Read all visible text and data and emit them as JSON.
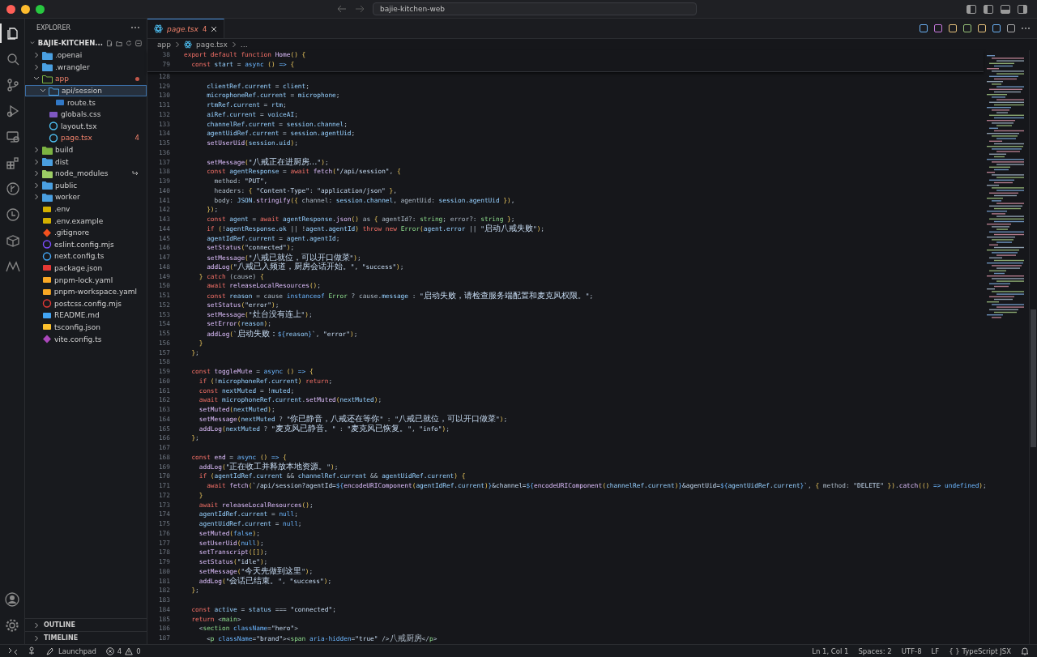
{
  "titlebar": {
    "search": "bajie-kitchen-web"
  },
  "activity_bar": [
    {
      "kind": "files",
      "selected": true
    },
    {
      "kind": "search",
      "selected": false
    },
    {
      "kind": "source-control",
      "selected": false
    },
    {
      "kind": "run-debug",
      "selected": false
    },
    {
      "kind": "remote",
      "selected": false
    },
    {
      "kind": "extensions",
      "selected": false
    },
    {
      "kind": "graph",
      "selected": false
    },
    {
      "kind": "history",
      "selected": false
    },
    {
      "kind": "box",
      "selected": false
    },
    {
      "kind": "m-logo",
      "selected": false
    }
  ],
  "explorer": {
    "title": "EXPLORER",
    "project": "BAJIE-KITCHEN...",
    "tree": [
      {
        "name": ".openai",
        "kind": "folder",
        "expanded": false,
        "selected": false,
        "problem": false
      },
      {
        "name": ".wrangler",
        "kind": "folder",
        "expanded": false,
        "selected": false,
        "problem": false
      },
      {
        "name": "app",
        "kind": "folder-app",
        "expanded": true,
        "selected": false,
        "problem": true,
        "children": [
          {
            "name": "api/session",
            "kind": "folder",
            "expanded": true,
            "selected": true,
            "problem": false,
            "children": [
              {
                "name": "route.ts",
                "kind": "ts",
                "selected": false,
                "problem": false
              }
            ]
          },
          {
            "name": "globals.css",
            "kind": "css",
            "selected": false,
            "problem": false
          },
          {
            "name": "layout.tsx",
            "kind": "react",
            "selected": false,
            "problem": false
          },
          {
            "name": "page.tsx",
            "kind": "react",
            "selected": false,
            "problem": true,
            "badge": "4"
          }
        ]
      },
      {
        "name": "build",
        "kind": "folder-build",
        "expanded": false,
        "selected": false,
        "problem": false
      },
      {
        "name": "dist",
        "kind": "folder",
        "expanded": false,
        "selected": false,
        "problem": false
      },
      {
        "name": "node_modules",
        "kind": "folder-linked",
        "expanded": false,
        "selected": false,
        "problem": false
      },
      {
        "name": "public",
        "kind": "folder",
        "expanded": false,
        "selected": false,
        "problem": false
      },
      {
        "name": "worker",
        "kind": "folder",
        "expanded": false,
        "selected": false,
        "problem": false
      },
      {
        "name": ".env",
        "kind": "env",
        "selected": false,
        "problem": false
      },
      {
        "name": ".env.example",
        "kind": "env",
        "selected": false,
        "problem": false
      },
      {
        "name": ".gitignore",
        "kind": "git",
        "selected": false,
        "problem": false
      },
      {
        "name": "eslint.config.mjs",
        "kind": "eslint",
        "selected": false,
        "problem": false
      },
      {
        "name": "next.config.ts",
        "kind": "next",
        "selected": false,
        "problem": false
      },
      {
        "name": "package.json",
        "kind": "npm",
        "selected": false,
        "problem": false
      },
      {
        "name": "pnpm-lock.yaml",
        "kind": "yaml",
        "selected": false,
        "problem": false
      },
      {
        "name": "pnpm-workspace.yaml",
        "kind": "yaml",
        "selected": false,
        "problem": false
      },
      {
        "name": "postcss.config.mjs",
        "kind": "postcss",
        "selected": false,
        "problem": false
      },
      {
        "name": "README.md",
        "kind": "md",
        "selected": false,
        "problem": false
      },
      {
        "name": "tsconfig.json",
        "kind": "json",
        "selected": false,
        "problem": false
      },
      {
        "name": "vite.config.ts",
        "kind": "vite",
        "selected": false,
        "problem": false
      }
    ],
    "sections": [
      {
        "title": "OUTLINE",
        "expanded": false
      },
      {
        "title": "TIMELINE",
        "expanded": false
      }
    ]
  },
  "editor": {
    "tabs": [
      {
        "name": "page.tsx",
        "badge": "4",
        "selected": true,
        "problem": true
      }
    ],
    "breadcrumbs": [
      {
        "text": "app",
        "kind": "folder"
      },
      {
        "text": "page.tsx",
        "kind": "react"
      },
      {
        "text": "…",
        "kind": "more"
      }
    ],
    "sticky_lines": [
      {
        "number": "38",
        "tokens": [
          {
            "kind": "kw",
            "text": "export default function "
          },
          {
            "kind": "fn",
            "text": "Home"
          },
          {
            "kind": "br",
            "text": "() {"
          }
        ]
      },
      {
        "number": "79",
        "tokens": [
          {
            "kind": "kw",
            "text": "  const "
          },
          {
            "kind": "var",
            "text": "start"
          },
          {
            "kind": "pl",
            "text": " = "
          },
          {
            "kind": "st",
            "text": "async "
          },
          {
            "kind": "br",
            "text": "()"
          },
          {
            "kind": "st",
            "text": " => "
          },
          {
            "kind": "br",
            "text": "{"
          }
        ]
      }
    ],
    "lines": [
      {
        "number": "128"
      },
      {
        "number": "129",
        "tokens": [
          {
            "kind": "var",
            "text": "      clientRef.current"
          },
          {
            "kind": "pl",
            "text": " = "
          },
          {
            "kind": "var",
            "text": "client"
          },
          {
            "kind": "pl",
            "text": ";"
          }
        ]
      },
      {
        "number": "130",
        "tokens": [
          {
            "kind": "var",
            "text": "      microphoneRef.current"
          },
          {
            "kind": "pl",
            "text": " = "
          },
          {
            "kind": "var",
            "text": "microphone"
          },
          {
            "kind": "pl",
            "text": ";"
          }
        ]
      },
      {
        "number": "131",
        "tokens": [
          {
            "kind": "var",
            "text": "      rtmRef.current"
          },
          {
            "kind": "pl",
            "text": " = "
          },
          {
            "kind": "var",
            "text": "rtm"
          },
          {
            "kind": "pl",
            "text": ";"
          }
        ]
      },
      {
        "number": "132",
        "tokens": [
          {
            "kind": "var",
            "text": "      aiRef.current"
          },
          {
            "kind": "pl",
            "text": " = "
          },
          {
            "kind": "var",
            "text": "voiceAI"
          },
          {
            "kind": "pl",
            "text": ";"
          }
        ]
      },
      {
        "number": "133",
        "tokens": [
          {
            "kind": "var",
            "text": "      channelRef.current"
          },
          {
            "kind": "pl",
            "text": " = "
          },
          {
            "kind": "var",
            "text": "session.channel"
          },
          {
            "kind": "pl",
            "text": ";"
          }
        ]
      },
      {
        "number": "134",
        "tokens": [
          {
            "kind": "var",
            "text": "      agentUidRef.current"
          },
          {
            "kind": "pl",
            "text": " = "
          },
          {
            "kind": "var",
            "text": "session.agentUid"
          },
          {
            "kind": "pl",
            "text": ";"
          }
        ]
      },
      {
        "number": "135",
        "tokens": [
          {
            "kind": "fn",
            "text": "      setUserUid"
          },
          {
            "kind": "br",
            "text": "("
          },
          {
            "kind": "var",
            "text": "session.uid"
          },
          {
            "kind": "br",
            "text": ")"
          },
          {
            "kind": "pl",
            "text": ";"
          }
        ]
      },
      {
        "number": "136"
      },
      {
        "number": "137",
        "tokens": [
          {
            "kind": "fn",
            "text": "      setMessage"
          },
          {
            "kind": "br",
            "text": "("
          },
          {
            "kind": "str",
            "text": "\"八戒正在进厨房…\""
          },
          {
            "kind": "br",
            "text": ")"
          },
          {
            "kind": "pl",
            "text": ";"
          }
        ]
      },
      {
        "number": "138",
        "tokens": [
          {
            "kind": "kw",
            "text": "      const "
          },
          {
            "kind": "var",
            "text": "agentResponse"
          },
          {
            "kind": "pl",
            "text": " = "
          },
          {
            "kind": "kw",
            "text": "await "
          },
          {
            "kind": "fn",
            "text": "fetch"
          },
          {
            "kind": "br",
            "text": "("
          },
          {
            "kind": "str",
            "text": "\"/api/session\""
          },
          {
            "kind": "pl",
            "text": ", "
          },
          {
            "kind": "br",
            "text": "{"
          }
        ]
      },
      {
        "number": "139",
        "tokens": [
          {
            "kind": "pl",
            "text": "        method: "
          },
          {
            "kind": "str",
            "text": "\"PUT\""
          },
          {
            "kind": "pl",
            "text": ","
          }
        ]
      },
      {
        "number": "140",
        "tokens": [
          {
            "kind": "pl",
            "text": "        headers: "
          },
          {
            "kind": "br",
            "text": "{ "
          },
          {
            "kind": "str",
            "text": "\"Content-Type\""
          },
          {
            "kind": "pl",
            "text": ": "
          },
          {
            "kind": "str",
            "text": "\"application/json\""
          },
          {
            "kind": "br",
            "text": " }"
          },
          {
            "kind": "pl",
            "text": ","
          }
        ]
      },
      {
        "number": "141",
        "tokens": [
          {
            "kind": "pl",
            "text": "        body: "
          },
          {
            "kind": "var",
            "text": "JSON"
          },
          {
            "kind": "pl",
            "text": "."
          },
          {
            "kind": "fn",
            "text": "stringify"
          },
          {
            "kind": "br",
            "text": "({ "
          },
          {
            "kind": "pl",
            "text": "channel: "
          },
          {
            "kind": "var",
            "text": "session.channel"
          },
          {
            "kind": "pl",
            "text": ", agentUid: "
          },
          {
            "kind": "var",
            "text": "session.agentUid"
          },
          {
            "kind": "br",
            "text": " })"
          },
          {
            "kind": "pl",
            "text": ","
          }
        ]
      },
      {
        "number": "142",
        "tokens": [
          {
            "kind": "br",
            "text": "      })"
          },
          {
            "kind": "pl",
            "text": ";"
          }
        ]
      },
      {
        "number": "143",
        "tokens": [
          {
            "kind": "kw",
            "text": "      const "
          },
          {
            "kind": "var",
            "text": "agent"
          },
          {
            "kind": "pl",
            "text": " = "
          },
          {
            "kind": "kw",
            "text": "await "
          },
          {
            "kind": "var",
            "text": "agentResponse"
          },
          {
            "kind": "pl",
            "text": "."
          },
          {
            "kind": "fn",
            "text": "json"
          },
          {
            "kind": "br",
            "text": "()"
          },
          {
            "kind": "pl",
            "text": " as "
          },
          {
            "kind": "br",
            "text": "{ "
          },
          {
            "kind": "pl",
            "text": "agentId?: "
          },
          {
            "kind": "ty",
            "text": "string"
          },
          {
            "kind": "pl",
            "text": "; error?: "
          },
          {
            "kind": "ty",
            "text": "string"
          },
          {
            "kind": "br",
            "text": " }"
          },
          {
            "kind": "pl",
            "text": ";"
          }
        ]
      },
      {
        "number": "144",
        "tokens": [
          {
            "kind": "kw",
            "text": "      if "
          },
          {
            "kind": "br",
            "text": "("
          },
          {
            "kind": "pl",
            "text": "!"
          },
          {
            "kind": "var",
            "text": "agentResponse.ok"
          },
          {
            "kind": "pl",
            "text": " || !"
          },
          {
            "kind": "var",
            "text": "agent.agentId"
          },
          {
            "kind": "br",
            "text": ")"
          },
          {
            "kind": "kw",
            "text": " throw new "
          },
          {
            "kind": "ty",
            "text": "Error"
          },
          {
            "kind": "br",
            "text": "("
          },
          {
            "kind": "var",
            "text": "agent.error"
          },
          {
            "kind": "pl",
            "text": " || "
          },
          {
            "kind": "str",
            "text": "\"启动八戒失败\""
          },
          {
            "kind": "br",
            "text": ")"
          },
          {
            "kind": "pl",
            "text": ";"
          }
        ]
      },
      {
        "number": "145",
        "tokens": [
          {
            "kind": "var",
            "text": "      agentIdRef.current"
          },
          {
            "kind": "pl",
            "text": " = "
          },
          {
            "kind": "var",
            "text": "agent.agentId"
          },
          {
            "kind": "pl",
            "text": ";"
          }
        ]
      },
      {
        "number": "146",
        "tokens": [
          {
            "kind": "fn",
            "text": "      setStatus"
          },
          {
            "kind": "br",
            "text": "("
          },
          {
            "kind": "str",
            "text": "\"connected\""
          },
          {
            "kind": "br",
            "text": ")"
          },
          {
            "kind": "pl",
            "text": ";"
          }
        ]
      },
      {
        "number": "147",
        "tokens": [
          {
            "kind": "fn",
            "text": "      setMessage"
          },
          {
            "kind": "br",
            "text": "("
          },
          {
            "kind": "str",
            "text": "\"八戒已就位，可以开口做菜\""
          },
          {
            "kind": "br",
            "text": ")"
          },
          {
            "kind": "pl",
            "text": ";"
          }
        ]
      },
      {
        "number": "148",
        "tokens": [
          {
            "kind": "fn",
            "text": "      addLog"
          },
          {
            "kind": "br",
            "text": "("
          },
          {
            "kind": "str",
            "text": "\"八戒已入频道，厨房会话开始。\""
          },
          {
            "kind": "pl",
            "text": ", "
          },
          {
            "kind": "str",
            "text": "\"success\""
          },
          {
            "kind": "br",
            "text": ")"
          },
          {
            "kind": "pl",
            "text": ";"
          }
        ]
      },
      {
        "number": "149",
        "tokens": [
          {
            "kind": "br",
            "text": "    }"
          },
          {
            "kind": "kw",
            "text": " catch "
          },
          {
            "kind": "pl",
            "text": "(cause) "
          },
          {
            "kind": "br",
            "text": "{"
          }
        ]
      },
      {
        "number": "150",
        "tokens": [
          {
            "kind": "kw",
            "text": "      await "
          },
          {
            "kind": "fn",
            "text": "releaseLocalResources"
          },
          {
            "kind": "br",
            "text": "()"
          },
          {
            "kind": "pl",
            "text": ";"
          }
        ]
      },
      {
        "number": "151",
        "tokens": [
          {
            "kind": "kw",
            "text": "      const "
          },
          {
            "kind": "var",
            "text": "reason"
          },
          {
            "kind": "pl",
            "text": " = cause "
          },
          {
            "kind": "st",
            "text": "instanceof "
          },
          {
            "kind": "ty",
            "text": "Error"
          },
          {
            "kind": "pl",
            "text": " ? cause."
          },
          {
            "kind": "var",
            "text": "message"
          },
          {
            "kind": "pl",
            "text": " : "
          },
          {
            "kind": "str",
            "text": "\"启动失败，请检查服务端配置和麦克风权限。\""
          },
          {
            "kind": "pl",
            "text": ";"
          }
        ]
      },
      {
        "number": "152",
        "tokens": [
          {
            "kind": "fn",
            "text": "      setStatus"
          },
          {
            "kind": "br",
            "text": "("
          },
          {
            "kind": "str",
            "text": "\"error\""
          },
          {
            "kind": "br",
            "text": ")"
          },
          {
            "kind": "pl",
            "text": ";"
          }
        ]
      },
      {
        "number": "153",
        "tokens": [
          {
            "kind": "fn",
            "text": "      setMessage"
          },
          {
            "kind": "br",
            "text": "("
          },
          {
            "kind": "str",
            "text": "\"灶台没有连上\""
          },
          {
            "kind": "br",
            "text": ")"
          },
          {
            "kind": "pl",
            "text": ";"
          }
        ]
      },
      {
        "number": "154",
        "tokens": [
          {
            "kind": "fn",
            "text": "      setError"
          },
          {
            "kind": "br",
            "text": "("
          },
          {
            "kind": "var",
            "text": "reason"
          },
          {
            "kind": "br",
            "text": ")"
          },
          {
            "kind": "pl",
            "text": ";"
          }
        ]
      },
      {
        "number": "155",
        "tokens": [
          {
            "kind": "fn",
            "text": "      addLog"
          },
          {
            "kind": "br",
            "text": "("
          },
          {
            "kind": "str",
            "text": "`启动失败："
          },
          {
            "kind": "st",
            "text": "${"
          },
          {
            "kind": "var",
            "text": "reason"
          },
          {
            "kind": "st",
            "text": "}"
          },
          {
            "kind": "str",
            "text": "`"
          },
          {
            "kind": "pl",
            "text": ", "
          },
          {
            "kind": "str",
            "text": "\"error\""
          },
          {
            "kind": "br",
            "text": ")"
          },
          {
            "kind": "pl",
            "text": ";"
          }
        ]
      },
      {
        "number": "156",
        "tokens": [
          {
            "kind": "br",
            "text": "    }"
          }
        ]
      },
      {
        "number": "157",
        "tokens": [
          {
            "kind": "br",
            "text": "  }"
          },
          {
            "kind": "pl",
            "text": ";"
          }
        ]
      },
      {
        "number": "158"
      },
      {
        "number": "159",
        "tokens": [
          {
            "kind": "kw",
            "text": "  const "
          },
          {
            "kind": "fn",
            "text": "toggleMute"
          },
          {
            "kind": "pl",
            "text": " = "
          },
          {
            "kind": "st",
            "text": "async "
          },
          {
            "kind": "br",
            "text": "()"
          },
          {
            "kind": "st",
            "text": " => "
          },
          {
            "kind": "br",
            "text": "{"
          }
        ]
      },
      {
        "number": "160",
        "tokens": [
          {
            "kind": "kw",
            "text": "    if "
          },
          {
            "kind": "br",
            "text": "("
          },
          {
            "kind": "pl",
            "text": "!"
          },
          {
            "kind": "var",
            "text": "microphoneRef.current"
          },
          {
            "kind": "br",
            "text": ")"
          },
          {
            "kind": "kw",
            "text": " return"
          },
          {
            "kind": "pl",
            "text": ";"
          }
        ]
      },
      {
        "number": "161",
        "tokens": [
          {
            "kind": "kw",
            "text": "    const "
          },
          {
            "kind": "var",
            "text": "nextMuted"
          },
          {
            "kind": "pl",
            "text": " = !"
          },
          {
            "kind": "var",
            "text": "muted"
          },
          {
            "kind": "pl",
            "text": ";"
          }
        ]
      },
      {
        "number": "162",
        "tokens": [
          {
            "kind": "kw",
            "text": "    await "
          },
          {
            "kind": "var",
            "text": "microphoneRef.current"
          },
          {
            "kind": "pl",
            "text": "."
          },
          {
            "kind": "fn",
            "text": "setMuted"
          },
          {
            "kind": "br",
            "text": "("
          },
          {
            "kind": "var",
            "text": "nextMuted"
          },
          {
            "kind": "br",
            "text": ")"
          },
          {
            "kind": "pl",
            "text": ";"
          }
        ]
      },
      {
        "number": "163",
        "tokens": [
          {
            "kind": "fn",
            "text": "    setMuted"
          },
          {
            "kind": "br",
            "text": "("
          },
          {
            "kind": "var",
            "text": "nextMuted"
          },
          {
            "kind": "br",
            "text": ")"
          },
          {
            "kind": "pl",
            "text": ";"
          }
        ]
      },
      {
        "number": "164",
        "tokens": [
          {
            "kind": "fn",
            "text": "    setMessage"
          },
          {
            "kind": "br",
            "text": "("
          },
          {
            "kind": "var",
            "text": "nextMuted"
          },
          {
            "kind": "pl",
            "text": " ? "
          },
          {
            "kind": "str",
            "text": "\"你已静音，八戒还在等你\""
          },
          {
            "kind": "pl",
            "text": " : "
          },
          {
            "kind": "str",
            "text": "\"八戒已就位，可以开口做菜\""
          },
          {
            "kind": "br",
            "text": ")"
          },
          {
            "kind": "pl",
            "text": ";"
          }
        ]
      },
      {
        "number": "165",
        "tokens": [
          {
            "kind": "fn",
            "text": "    addLog"
          },
          {
            "kind": "br",
            "text": "("
          },
          {
            "kind": "var",
            "text": "nextMuted"
          },
          {
            "kind": "pl",
            "text": " ? "
          },
          {
            "kind": "str",
            "text": "\"麦克风已静音。\""
          },
          {
            "kind": "pl",
            "text": " : "
          },
          {
            "kind": "str",
            "text": "\"麦克风已恢复。\""
          },
          {
            "kind": "pl",
            "text": ", "
          },
          {
            "kind": "str",
            "text": "\"info\""
          },
          {
            "kind": "br",
            "text": ")"
          },
          {
            "kind": "pl",
            "text": ";"
          }
        ]
      },
      {
        "number": "166",
        "tokens": [
          {
            "kind": "br",
            "text": "  }"
          },
          {
            "kind": "pl",
            "text": ";"
          }
        ]
      },
      {
        "number": "167"
      },
      {
        "number": "168",
        "tokens": [
          {
            "kind": "kw",
            "text": "  const "
          },
          {
            "kind": "fn",
            "text": "end"
          },
          {
            "kind": "pl",
            "text": " = "
          },
          {
            "kind": "st",
            "text": "async "
          },
          {
            "kind": "br",
            "text": "()"
          },
          {
            "kind": "st",
            "text": " => "
          },
          {
            "kind": "br",
            "text": "{"
          }
        ]
      },
      {
        "number": "169",
        "tokens": [
          {
            "kind": "fn",
            "text": "    addLog"
          },
          {
            "kind": "br",
            "text": "("
          },
          {
            "kind": "str",
            "text": "\"正在收工并释放本地资源。\""
          },
          {
            "kind": "br",
            "text": ")"
          },
          {
            "kind": "pl",
            "text": ";"
          }
        ]
      },
      {
        "number": "170",
        "tokens": [
          {
            "kind": "kw",
            "text": "    if "
          },
          {
            "kind": "br",
            "text": "("
          },
          {
            "kind": "var",
            "text": "agentIdRef.current"
          },
          {
            "kind": "pl",
            "text": " && "
          },
          {
            "kind": "var",
            "text": "channelRef.current"
          },
          {
            "kind": "pl",
            "text": " && "
          },
          {
            "kind": "var",
            "text": "agentUidRef.current"
          },
          {
            "kind": "br",
            "text": ") {"
          }
        ]
      },
      {
        "number": "171",
        "tokens": [
          {
            "kind": "kw",
            "text": "      await "
          },
          {
            "kind": "fn",
            "text": "fetch"
          },
          {
            "kind": "br",
            "text": "("
          },
          {
            "kind": "str",
            "text": "`/api/session?agentId="
          },
          {
            "kind": "st",
            "text": "${"
          },
          {
            "kind": "fn",
            "text": "encodeURIComponent"
          },
          {
            "kind": "br",
            "text": "("
          },
          {
            "kind": "var",
            "text": "agentIdRef.current"
          },
          {
            "kind": "br",
            "text": ")"
          },
          {
            "kind": "st",
            "text": "}"
          },
          {
            "kind": "str",
            "text": "&channel="
          },
          {
            "kind": "st",
            "text": "${"
          },
          {
            "kind": "fn",
            "text": "encodeURIComponent"
          },
          {
            "kind": "br",
            "text": "("
          },
          {
            "kind": "var",
            "text": "channelRef.current"
          },
          {
            "kind": "br",
            "text": ")"
          },
          {
            "kind": "st",
            "text": "}"
          },
          {
            "kind": "str",
            "text": "&agentUid="
          },
          {
            "kind": "st",
            "text": "${"
          },
          {
            "kind": "var",
            "text": "agentUidRef.current"
          },
          {
            "kind": "st",
            "text": "}"
          },
          {
            "kind": "str",
            "text": "`"
          },
          {
            "kind": "pl",
            "text": ", "
          },
          {
            "kind": "br",
            "text": "{ "
          },
          {
            "kind": "pl",
            "text": "method: "
          },
          {
            "kind": "str",
            "text": "\"DELETE\""
          },
          {
            "kind": "br",
            "text": " })"
          },
          {
            "kind": "pl",
            "text": "."
          },
          {
            "kind": "fn",
            "text": "catch"
          },
          {
            "kind": "br",
            "text": "(()"
          },
          {
            "kind": "st",
            "text": " => "
          },
          {
            "kind": "st",
            "text": "undefined"
          },
          {
            "kind": "br",
            "text": ")"
          },
          {
            "kind": "pl",
            "text": ";"
          }
        ]
      },
      {
        "number": "172",
        "tokens": [
          {
            "kind": "br",
            "text": "    }"
          }
        ]
      },
      {
        "number": "173",
        "tokens": [
          {
            "kind": "kw",
            "text": "    await "
          },
          {
            "kind": "fn",
            "text": "releaseLocalResources"
          },
          {
            "kind": "br",
            "text": "()"
          },
          {
            "kind": "pl",
            "text": ";"
          }
        ]
      },
      {
        "number": "174",
        "tokens": [
          {
            "kind": "var",
            "text": "    agentIdRef.current"
          },
          {
            "kind": "pl",
            "text": " = "
          },
          {
            "kind": "st",
            "text": "null"
          },
          {
            "kind": "pl",
            "text": ";"
          }
        ]
      },
      {
        "number": "175",
        "tokens": [
          {
            "kind": "var",
            "text": "    agentUidRef.current"
          },
          {
            "kind": "pl",
            "text": " = "
          },
          {
            "kind": "st",
            "text": "null"
          },
          {
            "kind": "pl",
            "text": ";"
          }
        ]
      },
      {
        "number": "176",
        "tokens": [
          {
            "kind": "fn",
            "text": "    setMuted"
          },
          {
            "kind": "br",
            "text": "("
          },
          {
            "kind": "st",
            "text": "false"
          },
          {
            "kind": "br",
            "text": ")"
          },
          {
            "kind": "pl",
            "text": ";"
          }
        ]
      },
      {
        "number": "177",
        "tokens": [
          {
            "kind": "fn",
            "text": "    setUserUid"
          },
          {
            "kind": "br",
            "text": "("
          },
          {
            "kind": "st",
            "text": "null"
          },
          {
            "kind": "br",
            "text": ")"
          },
          {
            "kind": "pl",
            "text": ";"
          }
        ]
      },
      {
        "number": "178",
        "tokens": [
          {
            "kind": "fn",
            "text": "    setTranscript"
          },
          {
            "kind": "br",
            "text": "([])"
          },
          {
            "kind": "pl",
            "text": ";"
          }
        ]
      },
      {
        "number": "179",
        "tokens": [
          {
            "kind": "fn",
            "text": "    setStatus"
          },
          {
            "kind": "br",
            "text": "("
          },
          {
            "kind": "str",
            "text": "\"idle\""
          },
          {
            "kind": "br",
            "text": ")"
          },
          {
            "kind": "pl",
            "text": ";"
          }
        ]
      },
      {
        "number": "180",
        "tokens": [
          {
            "kind": "fn",
            "text": "    setMessage"
          },
          {
            "kind": "br",
            "text": "("
          },
          {
            "kind": "str",
            "text": "\"今天先做到这里\""
          },
          {
            "kind": "br",
            "text": ")"
          },
          {
            "kind": "pl",
            "text": ";"
          }
        ]
      },
      {
        "number": "181",
        "tokens": [
          {
            "kind": "fn",
            "text": "    addLog"
          },
          {
            "kind": "br",
            "text": "("
          },
          {
            "kind": "str",
            "text": "\"会话已结束。\""
          },
          {
            "kind": "pl",
            "text": ", "
          },
          {
            "kind": "str",
            "text": "\"success\""
          },
          {
            "kind": "br",
            "text": ")"
          },
          {
            "kind": "pl",
            "text": ";"
          }
        ]
      },
      {
        "number": "182",
        "tokens": [
          {
            "kind": "br",
            "text": "  }"
          },
          {
            "kind": "pl",
            "text": ";"
          }
        ]
      },
      {
        "number": "183"
      },
      {
        "number": "184",
        "tokens": [
          {
            "kind": "kw",
            "text": "  const "
          },
          {
            "kind": "var",
            "text": "active"
          },
          {
            "kind": "pl",
            "text": " = "
          },
          {
            "kind": "var",
            "text": "status"
          },
          {
            "kind": "pl",
            "text": " === "
          },
          {
            "kind": "str",
            "text": "\"connected\""
          },
          {
            "kind": "pl",
            "text": ";"
          }
        ]
      },
      {
        "number": "185",
        "tokens": [
          {
            "kind": "kw",
            "text": "  return "
          },
          {
            "kind": "pl",
            "text": "<"
          },
          {
            "kind": "tag",
            "text": "main"
          },
          {
            "kind": "pl",
            "text": ">"
          }
        ]
      },
      {
        "number": "186",
        "tokens": [
          {
            "kind": "pl",
            "text": "    <"
          },
          {
            "kind": "tag",
            "text": "section"
          },
          {
            "kind": "attr",
            "text": " className"
          },
          {
            "kind": "pl",
            "text": "="
          },
          {
            "kind": "str",
            "text": "\"hero\""
          },
          {
            "kind": "pl",
            "text": ">"
          }
        ]
      },
      {
        "number": "187",
        "tokens": [
          {
            "kind": "pl",
            "text": "      <"
          },
          {
            "kind": "tag",
            "text": "p"
          },
          {
            "kind": "attr",
            "text": " className"
          },
          {
            "kind": "pl",
            "text": "="
          },
          {
            "kind": "str",
            "text": "\"brand\""
          },
          {
            "kind": "pl",
            "text": "><"
          },
          {
            "kind": "tag",
            "text": "span"
          },
          {
            "kind": "attr",
            "text": " aria-hidden"
          },
          {
            "kind": "pl",
            "text": "="
          },
          {
            "kind": "str",
            "text": "\"true\""
          },
          {
            "kind": "pl",
            "text": " />八戒厨房</"
          },
          {
            "kind": "tag",
            "text": "p"
          },
          {
            "kind": "pl",
            "text": ">"
          }
        ]
      }
    ]
  },
  "status_bar": {
    "launchpad": "Launchpad",
    "errors": "4",
    "warnings": "0",
    "items": [
      "Ln 1, Col 1",
      "Spaces: 2",
      "UTF-8",
      "LF"
    ],
    "language_icon": "{ }",
    "language": "TypeScript JSX"
  }
}
